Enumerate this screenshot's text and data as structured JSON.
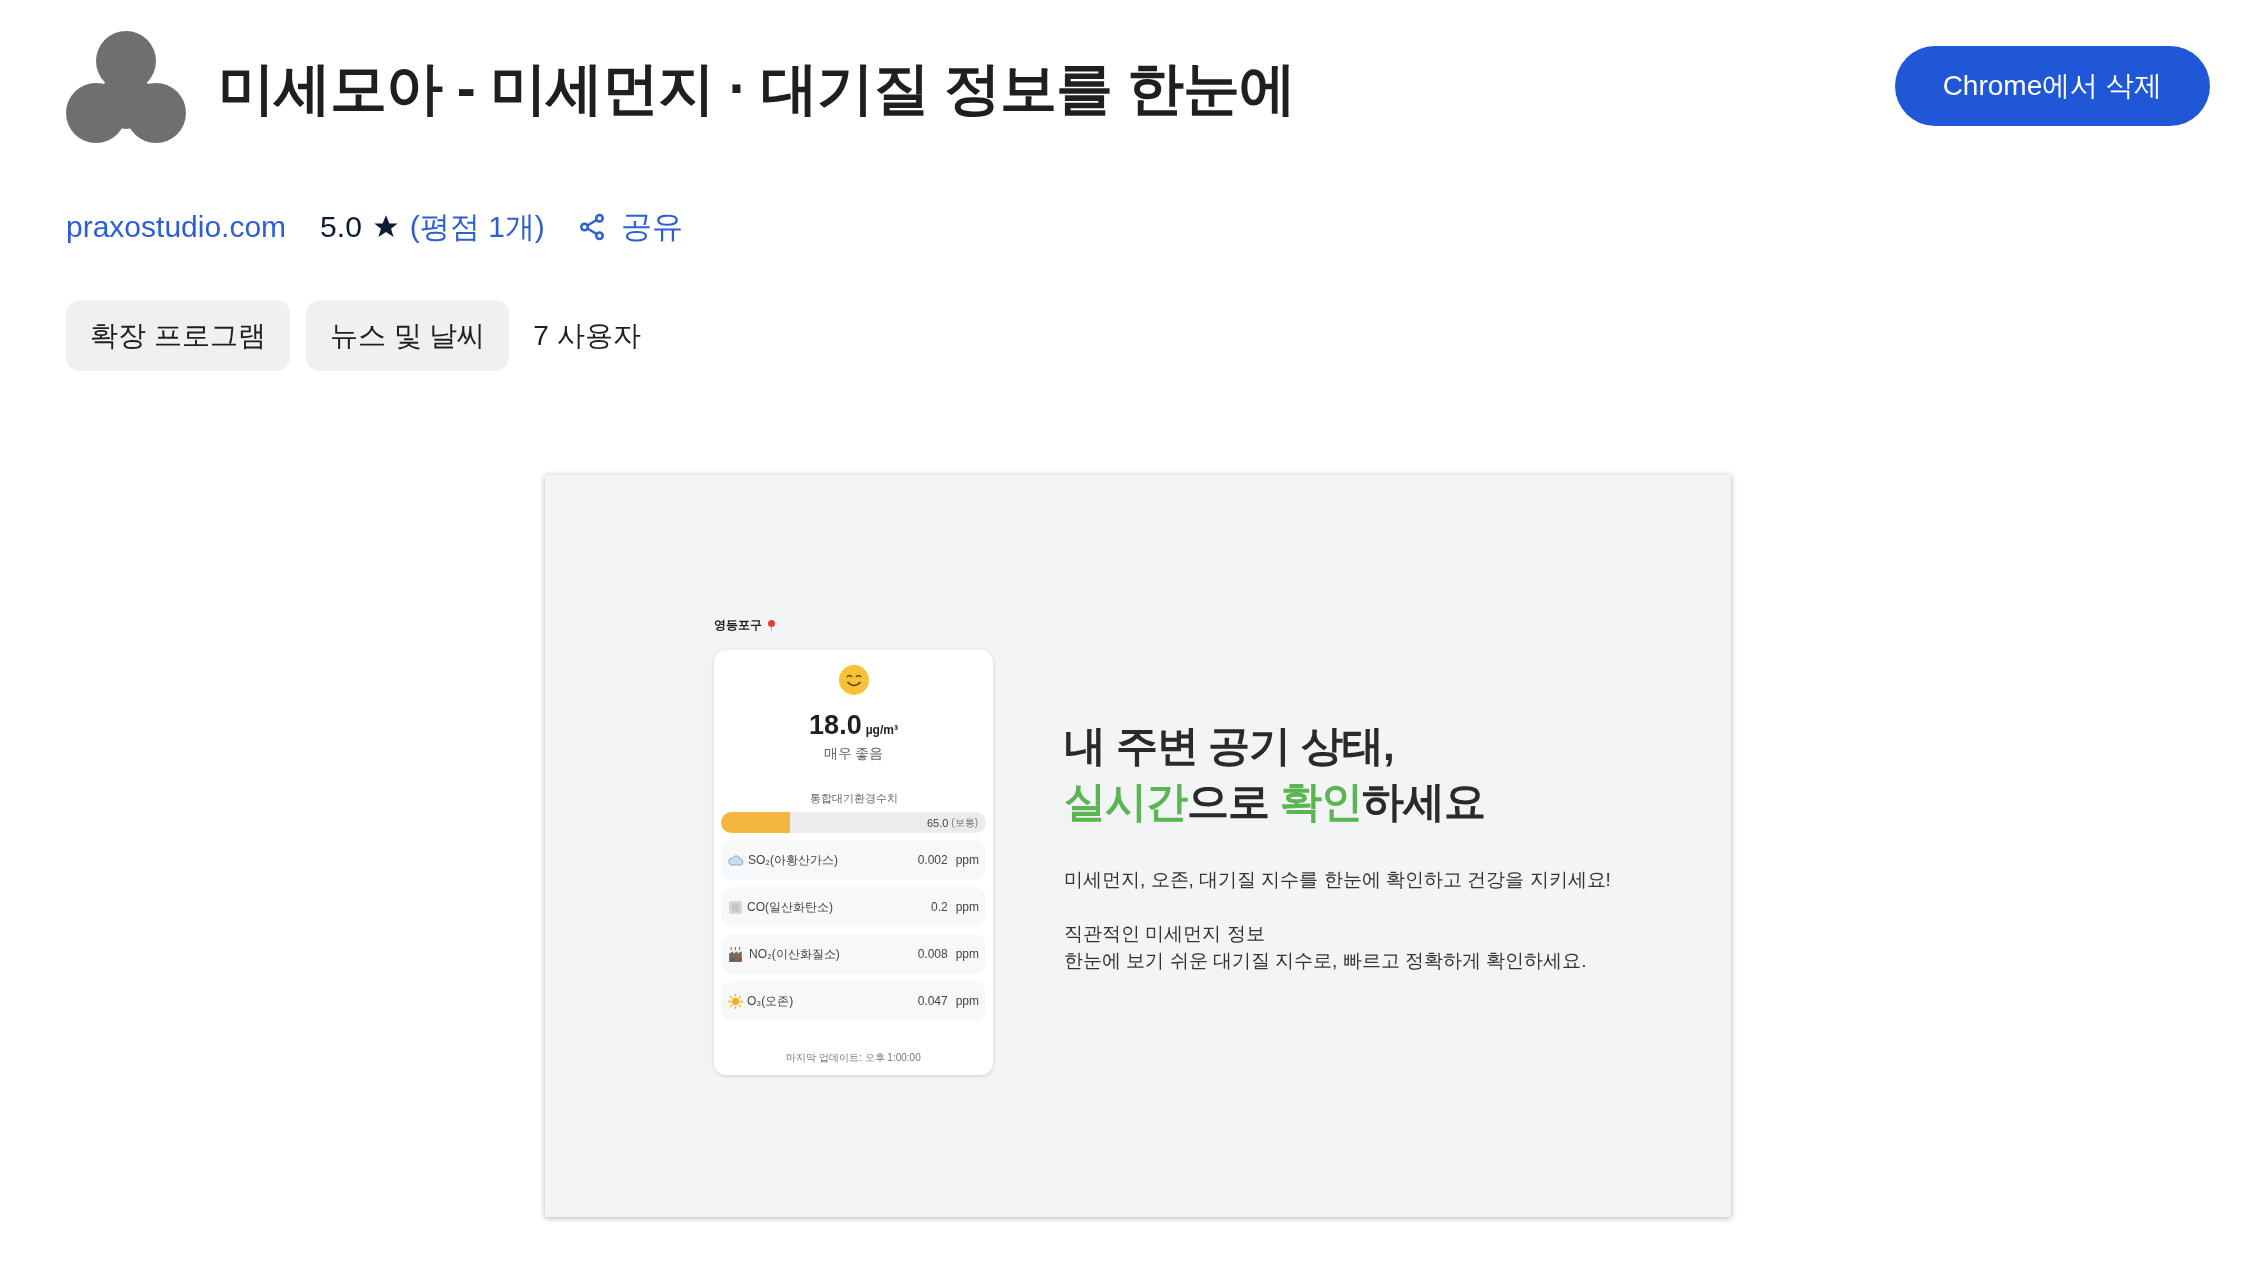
{
  "header": {
    "title": "미세모아 - 미세먼지 · 대기질 정보를 한눈에",
    "action_button": "Chrome에서 삭제"
  },
  "meta": {
    "publisher": "praxostudio.com",
    "rating": "5.0",
    "ratings_link": "(평점 1개)",
    "share": "공유"
  },
  "chips": [
    "확장 프로그램",
    "뉴스 및 날씨"
  ],
  "users": "7 사용자",
  "screenshot": {
    "location": "영등포구",
    "value": "18.0",
    "unit": "µg/m³",
    "grade": "매우 좋음",
    "index_label": "통합대기환경수치",
    "index": {
      "level": 0.26,
      "reading": "65.0",
      "grade": "(보통)"
    },
    "pollutants": [
      {
        "kind": "cloud",
        "name": "SO₂(아황산가스)",
        "value": "0.002",
        "unit": "ppm"
      },
      {
        "kind": "haze",
        "name": "CO(일산화탄소)",
        "value": "0.2",
        "unit": "ppm"
      },
      {
        "kind": "factory",
        "name": "NO₂(이산화질소)",
        "value": "0.008",
        "unit": "ppm"
      },
      {
        "kind": "sun",
        "name": "O₃(오존)",
        "value": "0.047",
        "unit": "ppm"
      }
    ],
    "updated": "마지막 업데이트: 오후 1:00:00",
    "headline": [
      [
        {
          "text": "내 주변 공기 상태,",
          "highlight": false
        }
      ],
      [
        {
          "text": "실시간",
          "highlight": true
        },
        {
          "text": "으로 ",
          "highlight": false
        },
        {
          "text": "확인",
          "highlight": true
        },
        {
          "text": "하세요",
          "highlight": false
        }
      ]
    ],
    "paragraphs": [
      "미세먼지, 오존, 대기질 지수를 한눈에 확인하고 건강을 지키세요!",
      "직관적인 미세먼지 정보",
      "한눈에 보기 쉬운 대기질 지수로, 빠르고 정확하게 확인하세요."
    ]
  }
}
